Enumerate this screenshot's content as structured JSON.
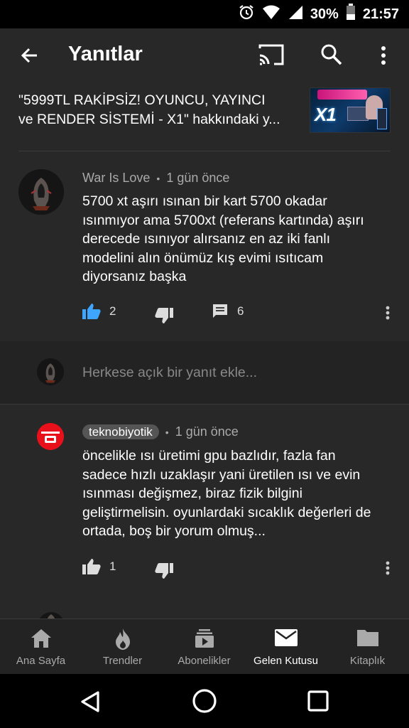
{
  "status_bar": {
    "battery": "30%",
    "time": "21:57"
  },
  "app_bar": {
    "title": "Yanıtlar"
  },
  "video": {
    "title_line1": "\"5999TL RAKİPSİZ! OYUNCU, YAYINCI",
    "title_line2": "ve RENDER SİSTEMİ - X1\" hakkındaki y...",
    "thumbnail_text": "X1"
  },
  "comment_main": {
    "author": "War Is Love",
    "separator": "•",
    "time": "1 gün önce",
    "text": "5700 xt aşırı ısınan bir kart 5700 okadar ısınmıyor ama 5700xt (referans kartında) aşırı derecede ısınıyor alırsanız en az iki fanlı modelini alın önümüz kış evimi ısıtıcam diyorsanız başka",
    "likes": "2",
    "replies": "6"
  },
  "reply_input": {
    "placeholder": "Herkese açık bir yanıt ekle..."
  },
  "reply_1": {
    "author": "teknobiyotik",
    "separator": "•",
    "time": "1 gün önce",
    "text": "öncelikle ısı üretimi gpu bazlıdır, fazla fan sadece hızlı uzaklaşır yani üretilen ısı ve evin ısınması değişmez, biraz fizik bilgini geliştirmelisin. oyunlardaki sıcaklık değerleri de ortada, boş bir yorum olmuş...",
    "likes": "1"
  },
  "bottom_nav": {
    "items": [
      {
        "label": "Ana Sayfa",
        "icon": "home-icon"
      },
      {
        "label": "Trendler",
        "icon": "flame-icon"
      },
      {
        "label": "Abonelikler",
        "icon": "subscriptions-icon"
      },
      {
        "label": "Gelen Kutusu",
        "icon": "mail-icon"
      },
      {
        "label": "Kitaplık",
        "icon": "folder-icon"
      }
    ],
    "active": "Gelen Kutusu"
  },
  "colors": {
    "background": "#282828",
    "like_active": "#3ea6ff",
    "reply_avatar_red": "#e8101a"
  }
}
